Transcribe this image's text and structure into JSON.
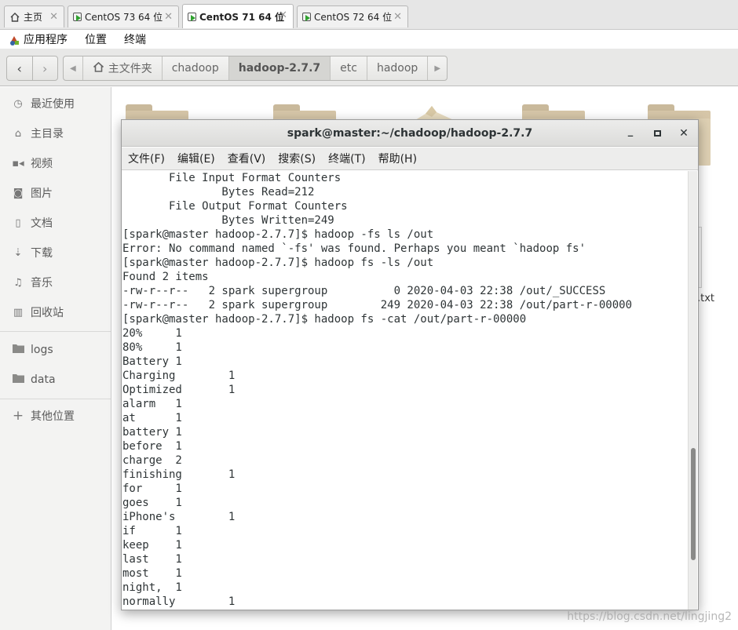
{
  "vm_tabs": [
    {
      "label": "主页",
      "icon": "home-icon",
      "active": false
    },
    {
      "label": "CentOS 73 64 位",
      "icon": "vm-running-icon",
      "active": false
    },
    {
      "label": "CentOS 71 64 位",
      "icon": "vm-running-icon",
      "active": true
    },
    {
      "label": "CentOS 72 64 位",
      "icon": "vm-running-icon",
      "active": false
    }
  ],
  "gnome_menu": {
    "applications": "应用程序",
    "places": "位置",
    "terminal": "终端"
  },
  "breadcrumb": {
    "home": "主文件夹",
    "items": [
      "chadoop",
      "hadoop-2.7.7",
      "etc",
      "hadoop"
    ],
    "current": "hadoop-2.7.7"
  },
  "sidebar": {
    "items": [
      {
        "label": "最近使用",
        "icon": "clock-icon"
      },
      {
        "label": "主目录",
        "icon": "home-icon"
      },
      {
        "label": "视频",
        "icon": "video-icon"
      },
      {
        "label": "图片",
        "icon": "camera-icon"
      },
      {
        "label": "文档",
        "icon": "document-icon"
      },
      {
        "label": "下载",
        "icon": "download-icon"
      },
      {
        "label": "音乐",
        "icon": "music-icon"
      },
      {
        "label": "回收站",
        "icon": "trash-icon"
      },
      {
        "label": "logs",
        "icon": "folder-icon"
      },
      {
        "label": "data",
        "icon": "folder-icon"
      },
      {
        "label": "其他位置",
        "icon": "plus-icon"
      }
    ]
  },
  "files": {
    "partial_file_label": ".txt"
  },
  "terminal": {
    "title": "spark@master:~/chadoop/hadoop-2.7.7",
    "minimize": "_",
    "maximize": "□",
    "close": "✕",
    "menu": [
      "文件(F)",
      "编辑(E)",
      "查看(V)",
      "搜索(S)",
      "终端(T)",
      "帮助(H)"
    ],
    "lines": [
      "       File Input Format Counters",
      "               Bytes Read=212",
      "       File Output Format Counters",
      "               Bytes Written=249",
      "[spark@master hadoop-2.7.7]$ hadoop -fs ls /out",
      "Error: No command named `-fs' was found. Perhaps you meant `hadoop fs'",
      "[spark@master hadoop-2.7.7]$ hadoop fs -ls /out",
      "Found 2 items",
      "-rw-r--r--   2 spark supergroup          0 2020-04-03 22:38 /out/_SUCCESS",
      "-rw-r--r--   2 spark supergroup        249 2020-04-03 22:38 /out/part-r-00000",
      "[spark@master hadoop-2.7.7]$ hadoop fs -cat /out/part-r-00000",
      "20%     1",
      "80%     1",
      "Battery 1",
      "Charging        1",
      "Optimized       1",
      "alarm   1",
      "at      1",
      "battery 1",
      "before  1",
      "charge  2",
      "finishing       1",
      "for     1",
      "goes    1",
      "iPhone's        1",
      "if      1",
      "keep    1",
      "last    1",
      "most    1",
      "night,  1",
      "normally        1"
    ]
  },
  "watermark": "https://blog.csdn.net/lingjing2"
}
